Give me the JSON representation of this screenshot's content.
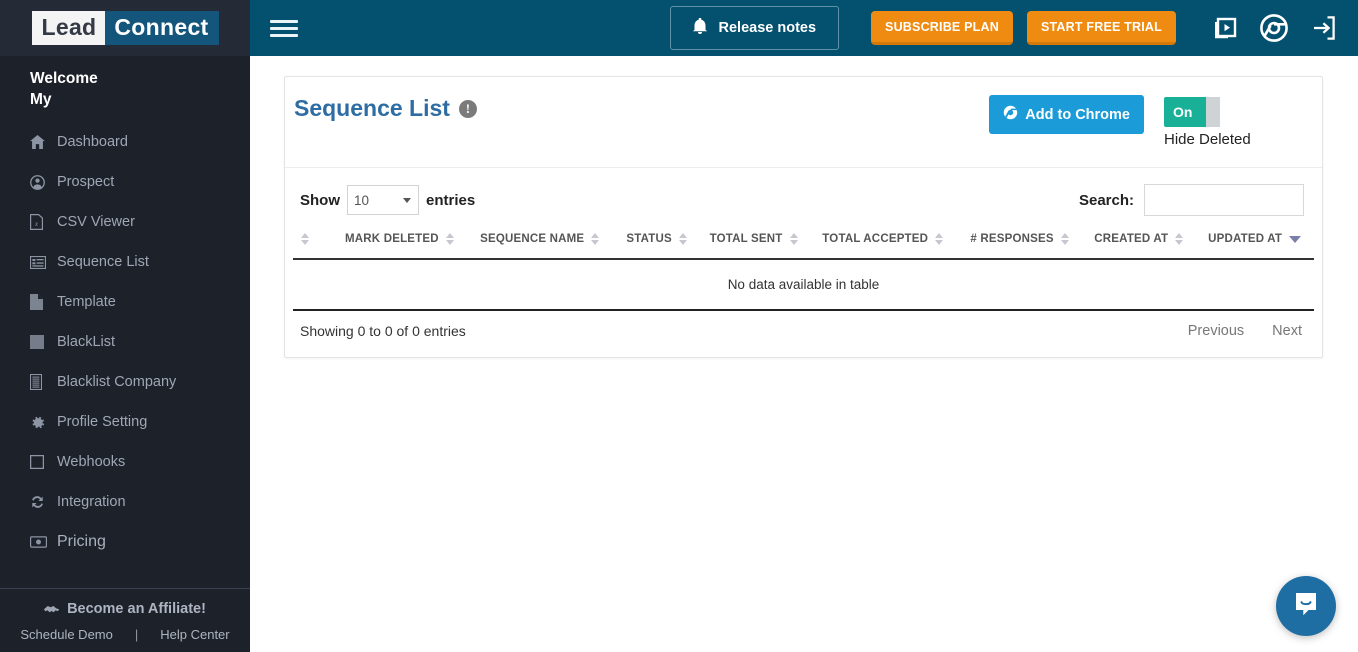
{
  "sidebar": {
    "logo": {
      "part1": "Lead",
      "part2": "Connect"
    },
    "welcome": {
      "line1": "Welcome",
      "line2": "My"
    },
    "items": [
      {
        "label": "Dashboard",
        "icon": "home-icon"
      },
      {
        "label": "Prospect",
        "icon": "user-circle-icon"
      },
      {
        "label": "CSV Viewer",
        "icon": "file-csv-icon"
      },
      {
        "label": "Sequence List",
        "icon": "list-icon"
      },
      {
        "label": "Template",
        "icon": "document-icon"
      },
      {
        "label": "BlackList",
        "icon": "square-icon"
      },
      {
        "label": "Blacklist Company",
        "icon": "building-icon"
      },
      {
        "label": "Profile Setting",
        "icon": "gear-icon"
      },
      {
        "label": "Webhooks",
        "icon": "square-outline-icon"
      },
      {
        "label": "Integration",
        "icon": "sync-icon"
      },
      {
        "label": "Pricing",
        "icon": "money-icon"
      }
    ],
    "affiliate": "Become an Affiliate!",
    "schedule_demo": "Schedule Demo",
    "help_center": "Help Center"
  },
  "topbar": {
    "release_notes": "Release notes",
    "subscribe_plan": "SUBSCRIBE PLAN",
    "start_free_trial": "START FREE TRIAL",
    "icons": [
      "video-library-icon",
      "chrome-icon",
      "sign-out-icon"
    ]
  },
  "card": {
    "title": "Sequence List",
    "info_icon": "!",
    "add_to_chrome": "Add to Chrome",
    "toggle_state": "On",
    "toggle_label": "Hide Deleted"
  },
  "table_controls": {
    "show_prefix": "Show",
    "page_length": "10",
    "show_suffix": "entries",
    "search_label": "Search:",
    "search_value": "",
    "search_placeholder": ""
  },
  "table": {
    "columns": [
      {
        "label": "",
        "sort": "none"
      },
      {
        "label": "MARK DELETED",
        "sort": "none"
      },
      {
        "label": "SEQUENCE NAME",
        "sort": "none"
      },
      {
        "label": "STATUS",
        "sort": "none"
      },
      {
        "label": "TOTAL SENT",
        "sort": "none"
      },
      {
        "label": "TOTAL ACCEPTED",
        "sort": "none"
      },
      {
        "label": "# RESPONSES",
        "sort": "none"
      },
      {
        "label": "CREATED AT",
        "sort": "none"
      },
      {
        "label": "UPDATED AT",
        "sort": "desc"
      }
    ],
    "rows": [],
    "empty_message": "No data available in table",
    "showing": "Showing 0 to 0 of 0 entries",
    "previous": "Previous",
    "next": "Next"
  },
  "chat": {
    "icon": "chat-bubble-icon"
  },
  "colors": {
    "header_blue": "#03506f",
    "sidebar_dark": "#1d2129",
    "accent_orange": "#f08b12",
    "chrome_blue": "#1b9bd8",
    "toggle_green": "#18b198",
    "title_blue": "#2e6da4"
  }
}
